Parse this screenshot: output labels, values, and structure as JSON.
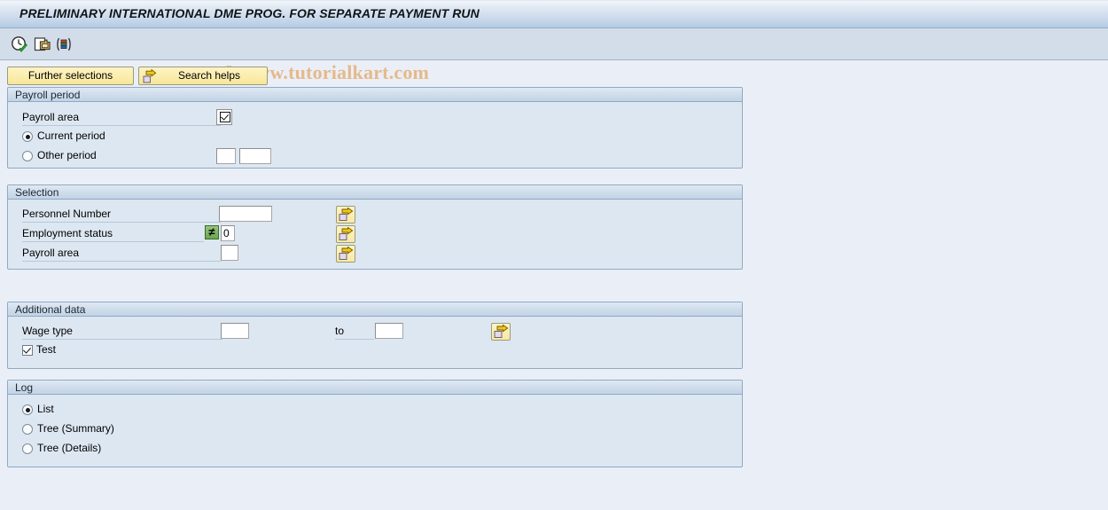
{
  "window": {
    "title": "PRELIMINARY INTERNATIONAL DME PROG. FOR SEPARATE PAYMENT RUN"
  },
  "watermark": {
    "text": "© www.tutorialkart.com"
  },
  "toolbar": {
    "icons": [
      {
        "name": "execute-clock-icon",
        "title": "Execute"
      },
      {
        "name": "copy-variant-icon",
        "title": "Get variant"
      },
      {
        "name": "color-bars-icon",
        "title": "Display"
      }
    ]
  },
  "buttons": {
    "further_selections": "Further selections",
    "search_helps": "Search helps"
  },
  "sections": {
    "payroll_period": {
      "header": "Payroll period",
      "payroll_area_label": "Payroll area",
      "payroll_area_value": "",
      "current_period_label": "Current period",
      "other_period_label": "Other period",
      "period_selected": "current",
      "other_period_value_1": "",
      "other_period_value_2": ""
    },
    "selection": {
      "header": "Selection",
      "rows": [
        {
          "label": "Personnel Number",
          "value": "",
          "operator": "",
          "has_operator": false
        },
        {
          "label": "Employment status",
          "value": "0",
          "operator": "≠",
          "has_operator": true
        },
        {
          "label": "Payroll area",
          "value": "",
          "operator": "",
          "has_operator": false
        }
      ]
    },
    "additional_data": {
      "header": "Additional data",
      "wage_type_label": "Wage type",
      "wage_type_from": "",
      "to_label": "to",
      "wage_type_to": "",
      "test_label": "Test",
      "test_checked": true
    },
    "log": {
      "header": "Log",
      "options": [
        {
          "label": "List",
          "selected": true
        },
        {
          "label": "Tree (Summary)",
          "selected": false
        },
        {
          "label": "Tree (Details)",
          "selected": false
        }
      ]
    }
  },
  "colors": {
    "page_bg": "#eaeff7",
    "titlebar_bottom": "#b4cbe3",
    "toolbar_bg": "#d3dde9",
    "group_bg": "#dde7f1",
    "group_border": "#8fa9c4",
    "button_yellow": "#fbeeae",
    "operator_green": "#6aa84f",
    "watermark": "#e6b98a"
  }
}
